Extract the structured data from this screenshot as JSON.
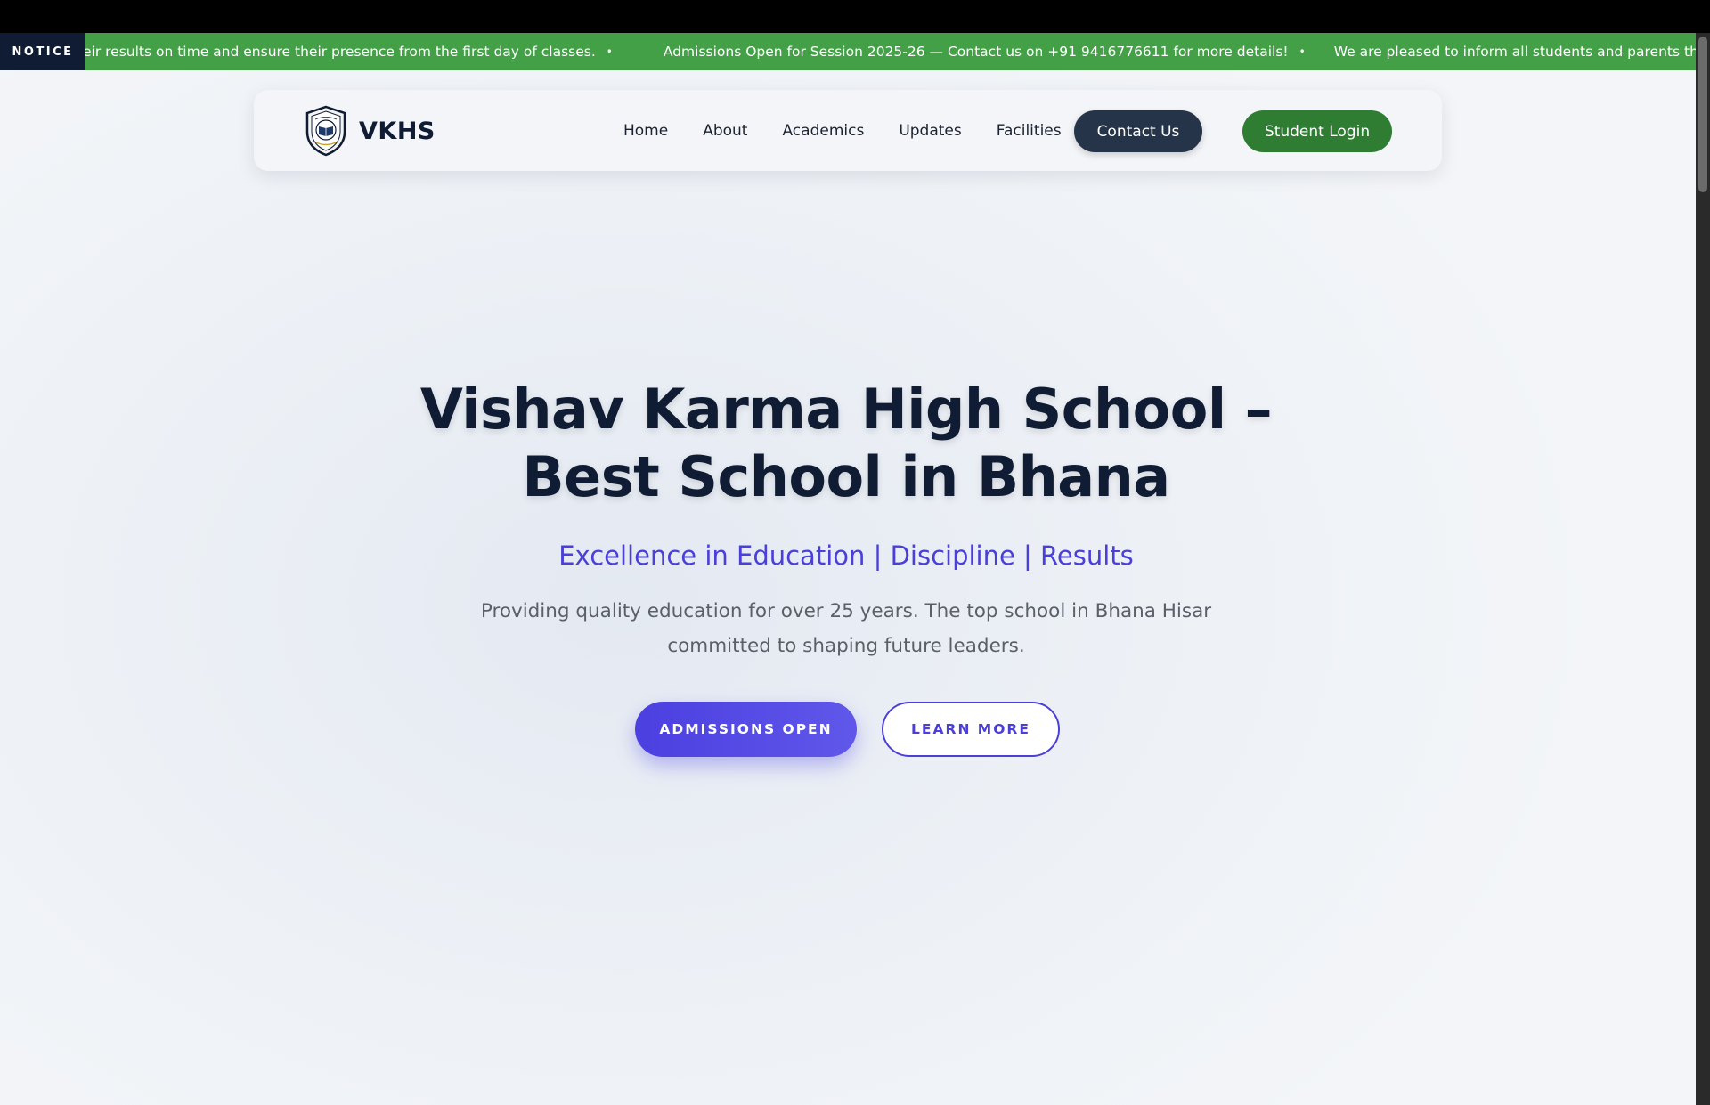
{
  "ticker": {
    "label": "NOTICE",
    "items": [
      "eir results on time and ensure their presence from the first day of classes.",
      "Admissions Open for Session 2025-26 — Contact us on +91 9416776611 for more details!",
      "We are pleased to inform all students and parents that the annu"
    ],
    "separator": "•"
  },
  "nav": {
    "brand": "VKHS",
    "logo_icon": "school-crest-icon",
    "links": [
      "Home",
      "About",
      "Academics",
      "Updates",
      "Facilities"
    ],
    "contact_label": "Contact Us",
    "login_label": "Student Login"
  },
  "hero": {
    "title_line1": "Vishav Karma High School –",
    "title_line2": "Best School in Bhana",
    "tagline": "Excellence in Education | Discipline | Results",
    "description": "Providing quality education for over 25 years. The top school in Bhana Hisar committed to shaping future leaders.",
    "primary_cta": "ADMISSIONS OPEN",
    "secondary_cta": "LEARN MORE"
  },
  "colors": {
    "ticker_bg": "#43a047",
    "notice_bg": "#0f1c33",
    "brand_dark": "#0f1c33",
    "accent": "#4b3fe0",
    "login_green": "#2e7d32",
    "contact_dark": "#26344a"
  }
}
